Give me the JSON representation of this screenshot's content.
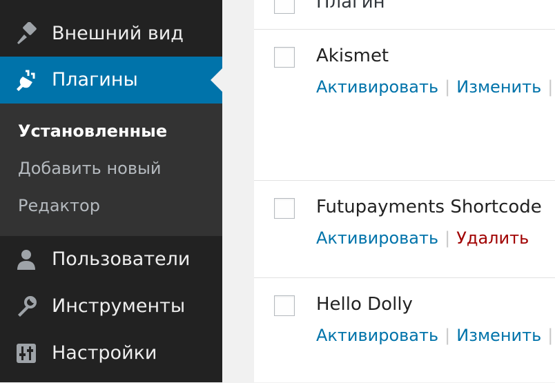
{
  "sidebar": {
    "items": [
      {
        "label": "Внешний вид",
        "icon": "paintbrush-icon"
      },
      {
        "label": "Плагины",
        "icon": "plugin-icon",
        "current": true
      },
      {
        "label": "Пользователи",
        "icon": "users-icon"
      },
      {
        "label": "Инструменты",
        "icon": "wrench-icon"
      },
      {
        "label": "Настройки",
        "icon": "settings-sliders-icon"
      }
    ],
    "submenu": [
      {
        "label": "Установленные",
        "active": true
      },
      {
        "label": "Добавить новый"
      },
      {
        "label": "Редактор"
      }
    ]
  },
  "plugins": {
    "header": "Плагин",
    "rows": [
      {
        "name": "Akismet",
        "action1": "Активировать",
        "action2": "Изменить"
      },
      {
        "name": "Futupayments Shortcode",
        "action1": "Активировать",
        "action2": "Удалить"
      },
      {
        "name": "Hello Dolly",
        "action1": "Активировать",
        "action2": "Изменить"
      }
    ]
  },
  "colors": {
    "sidebar_bg": "#222222",
    "submenu_bg": "#333333",
    "accent": "#0073aa",
    "link": "#0073aa",
    "delete": "#a00000"
  }
}
